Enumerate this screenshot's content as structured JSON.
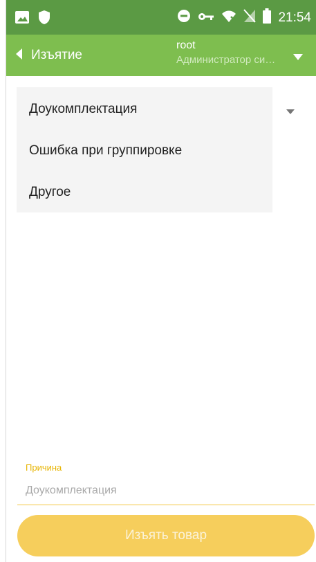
{
  "status_bar": {
    "time": "21:54",
    "icons": [
      "image-icon",
      "shield-icon",
      "do-not-disturb-icon",
      "key-icon",
      "wifi-off-icon",
      "no-sim-icon",
      "battery-icon"
    ]
  },
  "app_bar": {
    "back_label": "Изъятие",
    "user_name": "root",
    "user_role": "Администратор системы",
    "background_color": "#7ebe4f"
  },
  "reason_select": {
    "options": [
      "Доукомплектация",
      "Ошибка при группировке",
      "Другое"
    ],
    "label": "Причина",
    "value": "Доукомплектация"
  },
  "submit_button": {
    "label": "Изъять товар",
    "color": "#f6ce5c"
  }
}
